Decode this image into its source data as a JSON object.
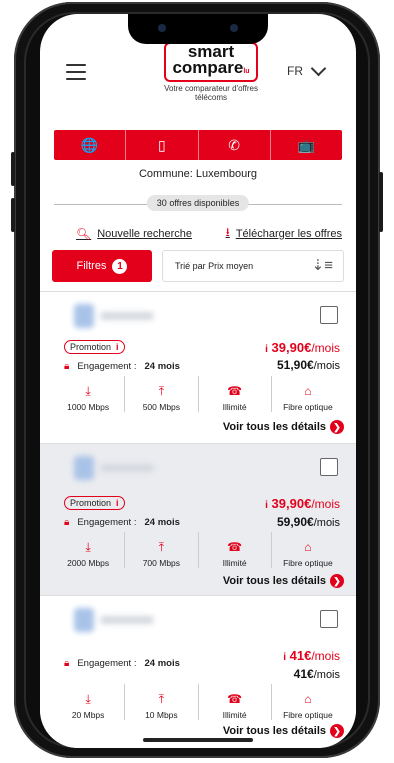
{
  "header": {
    "logo_line1": "smart",
    "logo_line2": "compare",
    "logo_suffix": "lu",
    "tagline": "Votre comparateur d'offres télécoms",
    "language": "FR"
  },
  "category_tabs": [
    {
      "icon": "globe-icon",
      "glyph": "🌐"
    },
    {
      "icon": "mobile-phone-icon",
      "glyph": "▯"
    },
    {
      "icon": "phone-call-icon",
      "glyph": "✆"
    },
    {
      "icon": "tv-icon",
      "glyph": "📺"
    }
  ],
  "commune_label": "Commune:  Luxembourg",
  "offers_count": "30  offres disponibles",
  "actions": {
    "new_search": "Nouvelle recherche",
    "download": "Télécharger les offres"
  },
  "filters": {
    "label": "Filtres",
    "count": "1",
    "sort_label": "Trié par  Prix moyen"
  },
  "offers": [
    {
      "promo": "Promotion",
      "price_sym": "i",
      "price": "39,90",
      "currency": "€",
      "unit": "/mois",
      "old_price": "51,90",
      "engagement_label": "Engagement :",
      "engagement_value": "24 mois",
      "download": "1000 Mbps",
      "upload": "500 Mbps",
      "data": "Illimité",
      "tech": "Fibre optique",
      "details": "Voir tous les détails"
    },
    {
      "promo": "Promotion",
      "price_sym": "i",
      "price": "39,90",
      "currency": "€",
      "unit": "/mois",
      "old_price": "59,90",
      "engagement_label": "Engagement :",
      "engagement_value": "24 mois",
      "download": "2000 Mbps",
      "upload": "700 Mbps",
      "data": "Illimité",
      "tech": "Fibre optique",
      "details": "Voir tous les détails"
    },
    {
      "promo": "",
      "price_sym": "i",
      "price": "41",
      "currency": "€",
      "unit": "/mois",
      "old_price": "41",
      "engagement_label": "Engagement :",
      "engagement_value": "24 mois",
      "download": "20 Mbps",
      "upload": "10 Mbps",
      "data": "Illimité",
      "tech": "Fibre optique",
      "details": "Voir tous les détails"
    }
  ],
  "colors": {
    "accent": "#e3001b",
    "card_alt": "#ebecf0"
  }
}
